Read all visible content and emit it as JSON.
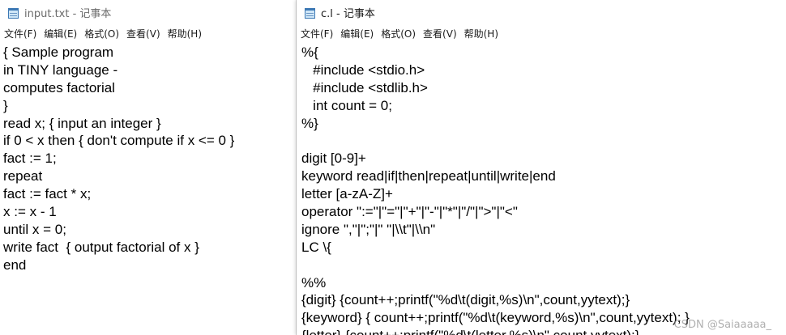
{
  "left_window": {
    "title": "input.txt - 记事本",
    "menu": [
      "文件(F)",
      "编辑(E)",
      "格式(O)",
      "查看(V)",
      "帮助(H)"
    ],
    "lines": [
      "{ Sample program",
      "in TINY language -",
      "computes factorial",
      "}",
      "read x; { input an integer }",
      "if 0 < x then { don't compute if x <= 0 }",
      "fact := 1;",
      "repeat",
      "fact := fact * x;",
      "x := x - 1",
      "until x = 0;",
      "write fact  { output factorial of x }",
      "end"
    ]
  },
  "right_window": {
    "title": "c.l - 记事本",
    "menu": [
      "文件(F)",
      "编辑(E)",
      "格式(O)",
      "查看(V)",
      "帮助(H)"
    ],
    "lines": [
      "%{",
      "   #include <stdio.h>",
      "   #include <stdlib.h>",
      "   int count = 0;",
      "%}",
      "",
      "digit [0-9]+",
      "keyword read|if|then|repeat|until|write|end",
      "letter [a-zA-Z]+",
      "operator \":=\"|\"=\"|\"+\"|\"-\"|\"*\"|\"/\"|\">\"|\"<\"",
      "ignore \",\"|\";\"|\" \"|\\\\t\"|\\\\n\"",
      "LC \\{",
      "",
      "%%",
      "{digit} {count++;printf(\"%d\\t(digit,%s)\\n\",count,yytext);}",
      "{keyword} { count++;printf(\"%d\\t(keyword,%s)\\n\",count,yytext); }",
      "{letter} {count++;printf(\"%d\\t(letter,%s)\\n\",count,yytext);}"
    ]
  },
  "watermark": "CSDN @Saiaaaaa_",
  "icons": {
    "app": "notepad-icon"
  },
  "colors": {
    "text": "#000000",
    "menu_text": "#1a1a1a",
    "inactive_title": "#6b6b6b",
    "notepad_blue": "#3c78b4"
  }
}
